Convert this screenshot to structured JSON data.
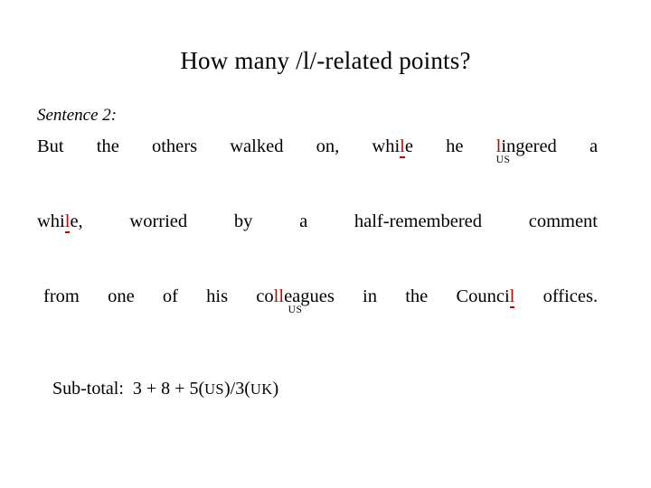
{
  "slide": {
    "title": "How many /l/-related points?",
    "background_color": "#ffffff",
    "text_color": "#000000",
    "highlight_color": "#b40a0a"
  },
  "sentence_label": "Sentence 2:",
  "sentence_lines": [
    {
      "id": "line-1",
      "words": [
        "But",
        "the",
        "others",
        "walked",
        "on,",
        "while",
        "he",
        "lingered",
        "a"
      ],
      "plain_text": "But the others walked on, while he lingered a"
    },
    {
      "id": "line-2",
      "words": [
        "while,",
        "worried",
        "by",
        "a",
        "half-remembered",
        "comment"
      ],
      "plain_text": "while, worried by a half-remembered comment"
    },
    {
      "id": "line-3",
      "words": [
        "from",
        "one",
        "of",
        "his",
        "colleagues",
        "in",
        "the",
        "Council",
        "offices."
      ],
      "plain_text": "from one of his colleagues in the Council offices."
    }
  ],
  "line1": {
    "w1": "But",
    "w2": "the",
    "w3": "others",
    "w4": "walked",
    "w5": "on,",
    "while_pre": "whi",
    "while_l": "l",
    "while_post": "e",
    "w7": "he",
    "lingered_l": "l",
    "lingered_post": "ingered",
    "lingered_tag": "US",
    "w9": "a"
  },
  "line2": {
    "while_pre": "whi",
    "while_l": "l",
    "while_post": "e,",
    "w2": "worried",
    "w3": "by",
    "w4": "a",
    "w5": "half-remembered",
    "w6": "comment"
  },
  "line3": {
    "w1": "from",
    "w2": "one",
    "w3": "of",
    "w4": "his",
    "colleagues_pre": "co",
    "colleagues_ll": "ll",
    "colleagues_post": "eagues",
    "colleagues_tag": "US",
    "w6": "in",
    "w7": "the",
    "council_pre": "Counci",
    "council_l": "l",
    "w9": "offices."
  },
  "subtotal": {
    "label": "Sub-total:",
    "expression_a": "3 + 8 + 5(",
    "tag_us": "US",
    "expression_b": ")/3(",
    "tag_uk": "UK",
    "expression_c": ")",
    "full_text": "Sub-total: 3 + 8 + 5(US)/3(UK)"
  }
}
